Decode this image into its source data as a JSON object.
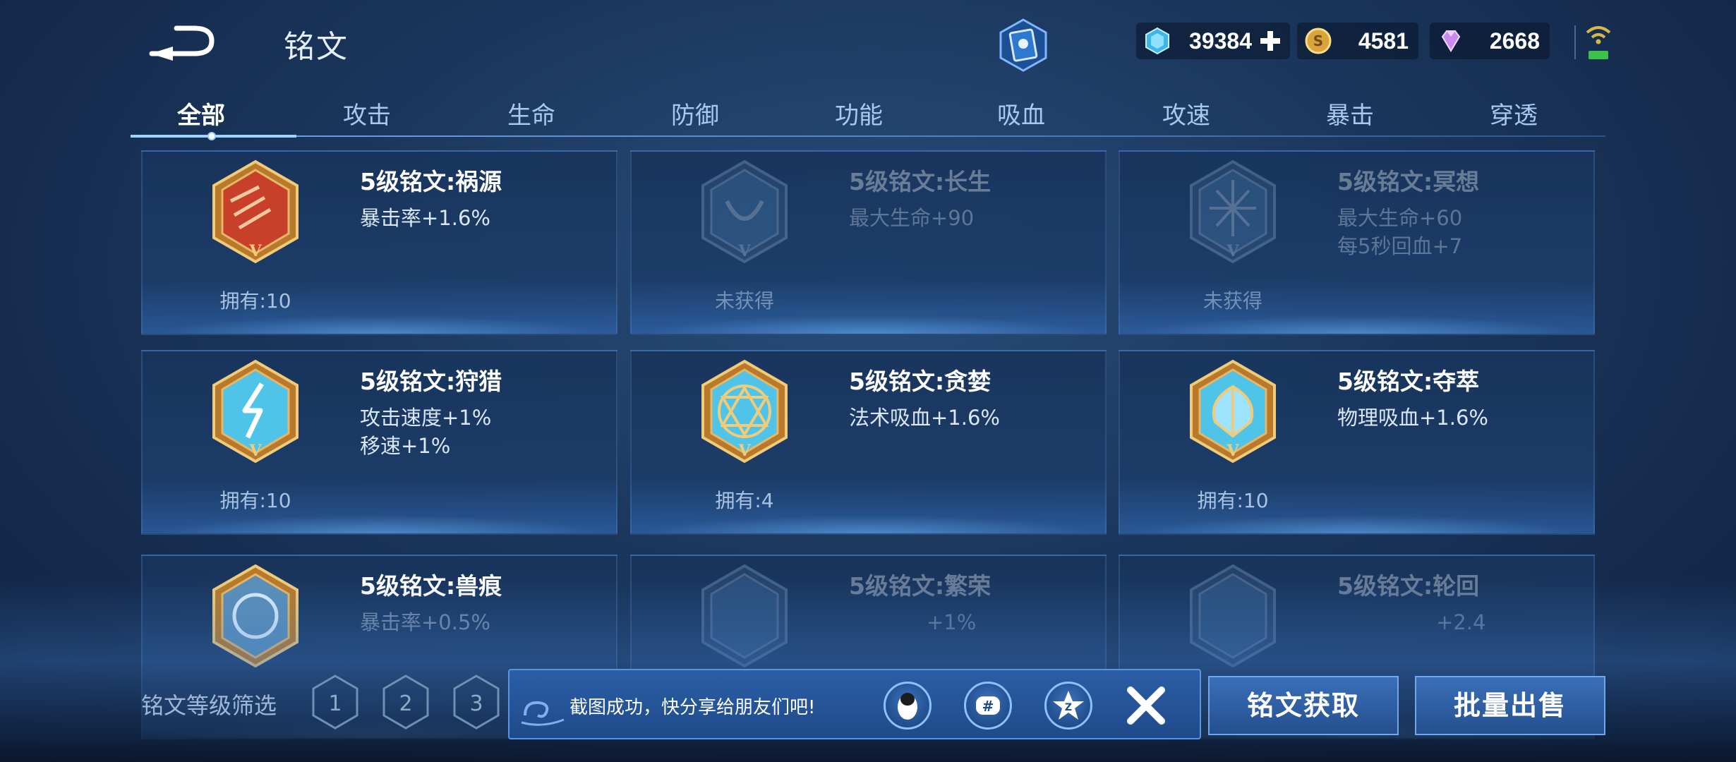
{
  "header": {
    "title": "铭文",
    "currencies": [
      {
        "name": "gem-icon",
        "value": "39384"
      },
      {
        "name": "gold-coin-icon",
        "value": "4581"
      },
      {
        "name": "diamond-icon",
        "value": "2668"
      }
    ]
  },
  "tabs": [
    "全部",
    "攻击",
    "生命",
    "防御",
    "功能",
    "吸血",
    "攻速",
    "暴击",
    "穿透"
  ],
  "active_tab": "全部",
  "cards": [
    {
      "name": "5级铭文:祸源",
      "stats": [
        "暴击率+1.6%",
        ""
      ],
      "owned": "拥有:10",
      "locked": false,
      "color": "#c8402a"
    },
    {
      "name": "5级铭文:长生",
      "stats": [
        "最大生命+90",
        ""
      ],
      "owned": "未获得",
      "locked": true,
      "color": "#4a7fb0"
    },
    {
      "name": "5级铭文:冥想",
      "stats": [
        "最大生命+60",
        "每5秒回血+7"
      ],
      "owned": "未获得",
      "locked": true,
      "color": "#4a7fb0"
    },
    {
      "name": "5级铭文:狩猎",
      "stats": [
        "攻击速度+1%",
        "移速+1%"
      ],
      "owned": "拥有:10",
      "locked": false,
      "color": "#4fc4e8"
    },
    {
      "name": "5级铭文:贪婪",
      "stats": [
        "法术吸血+1.6%",
        ""
      ],
      "owned": "拥有:4",
      "locked": false,
      "color": "#4fc4e8"
    },
    {
      "name": "5级铭文:夺萃",
      "stats": [
        "物理吸血+1.6%",
        ""
      ],
      "owned": "拥有:10",
      "locked": false,
      "color": "#4fc4e8"
    },
    {
      "name": "5级铭文:兽痕",
      "stats": [
        "暴击率+0.5%",
        ""
      ],
      "owned": "",
      "locked": false,
      "color": "#5a8fb8"
    },
    {
      "name": "5级铭文:繁荣",
      "stats": [
        "+1%",
        ""
      ],
      "owned": "",
      "locked": true,
      "color": "#4a7fb0"
    },
    {
      "name": "5级铭文:轮回",
      "stats": [
        "+2.4",
        ""
      ],
      "owned": "",
      "locked": true,
      "color": "#4a7fb0"
    }
  ],
  "bottom": {
    "filter_label": "铭文等级筛选",
    "levels": [
      "1",
      "2",
      "3"
    ],
    "toast_message": "截图成功，快分享给朋友们吧!",
    "obtain_button": "铭文获取",
    "sell_button": "批量出售"
  }
}
